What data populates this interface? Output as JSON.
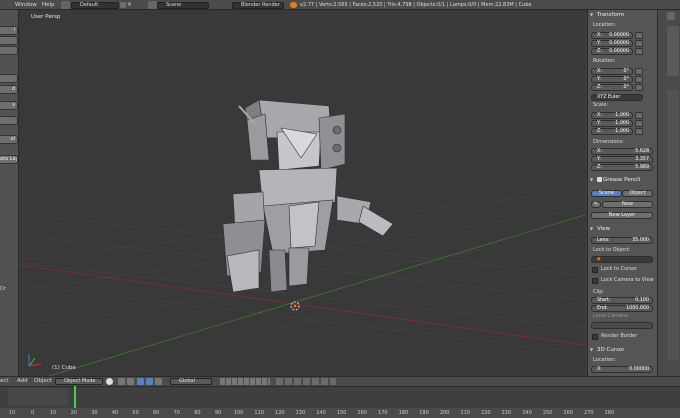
{
  "top": {
    "menus": [
      "Window",
      "Help"
    ],
    "layout": "Default",
    "scene": "Scene",
    "engine": "Blender Render",
    "stats": "v2.77 | Verts:2,565 | Faces:2,520 | Tris:4,798 | Objects:0/1 | Lamps:0/0 | Mem:22.83M | Cube"
  },
  "left": [
    "l",
    "d",
    "s",
    "",
    "al",
    "ata Layo",
    "Dr"
  ],
  "viewport": {
    "view_label": "User Persp",
    "object_label": "(1) Cube"
  },
  "panel": {
    "transform": "Transform",
    "location": "Location:",
    "loc": [
      {
        "k": "X:",
        "v": "0.00000"
      },
      {
        "k": "Y:",
        "v": "0.00000"
      },
      {
        "k": "Z:",
        "v": "0.00000"
      }
    ],
    "rotation": "Rotation:",
    "rot": [
      {
        "k": "X:",
        "v": "0°"
      },
      {
        "k": "Y:",
        "v": "0°"
      },
      {
        "k": "Z:",
        "v": "0°"
      }
    ],
    "rotmode": "XYZ Euler",
    "scale": "Scale:",
    "scl": [
      {
        "k": "X:",
        "v": "1.000"
      },
      {
        "k": "Y:",
        "v": "1.000"
      },
      {
        "k": "Z:",
        "v": "1.000"
      }
    ],
    "dimensions": "Dimensions:",
    "dim": [
      {
        "k": "X:",
        "v": "5.628"
      },
      {
        "k": "Y:",
        "v": "3.357"
      },
      {
        "k": "Z:",
        "v": "5.989"
      }
    ],
    "grease": "Grease Pencil",
    "gp_scene": "Scene",
    "gp_object": "Object",
    "gp_new": "New",
    "gp_newlayer": "New Layer",
    "view": "View",
    "lens": "Lens:",
    "lens_v": "35.000",
    "lock_obj": "Lock to Object:",
    "lock_cursor": "Lock to Cursor",
    "lock_cam": "Lock Camera to View",
    "clip": "Clip:",
    "clip_start": "Start:",
    "clip_start_v": "0.100",
    "clip_end": "End:",
    "clip_end_v": "1000.000",
    "local_camera": "Local Camera:",
    "render_border": "Render Border",
    "cursor3d": "3D Cursor",
    "cursor_loc": "Location:",
    "cursor_x": "X:",
    "cursor_x_v": "0.00000"
  },
  "bottom": {
    "menus": [
      "ect",
      "Add",
      "Object"
    ],
    "mode": "Object Mode",
    "pivot": "Global"
  },
  "timeline": {
    "ticks": [
      "10",
      "0",
      "10",
      "20",
      "30",
      "40",
      "50",
      "60",
      "70",
      "80",
      "90",
      "100",
      "110",
      "120",
      "130",
      "140",
      "150",
      "160",
      "170",
      "180",
      "190",
      "200",
      "210",
      "220",
      "230",
      "240",
      "250",
      "260",
      "270",
      "280"
    ]
  },
  "colors": {
    "accent": "#5680c2",
    "header": "#4b4b4b",
    "viewport": "#393939",
    "panel": "#555555",
    "frame_cursor": "#3fd24d"
  }
}
